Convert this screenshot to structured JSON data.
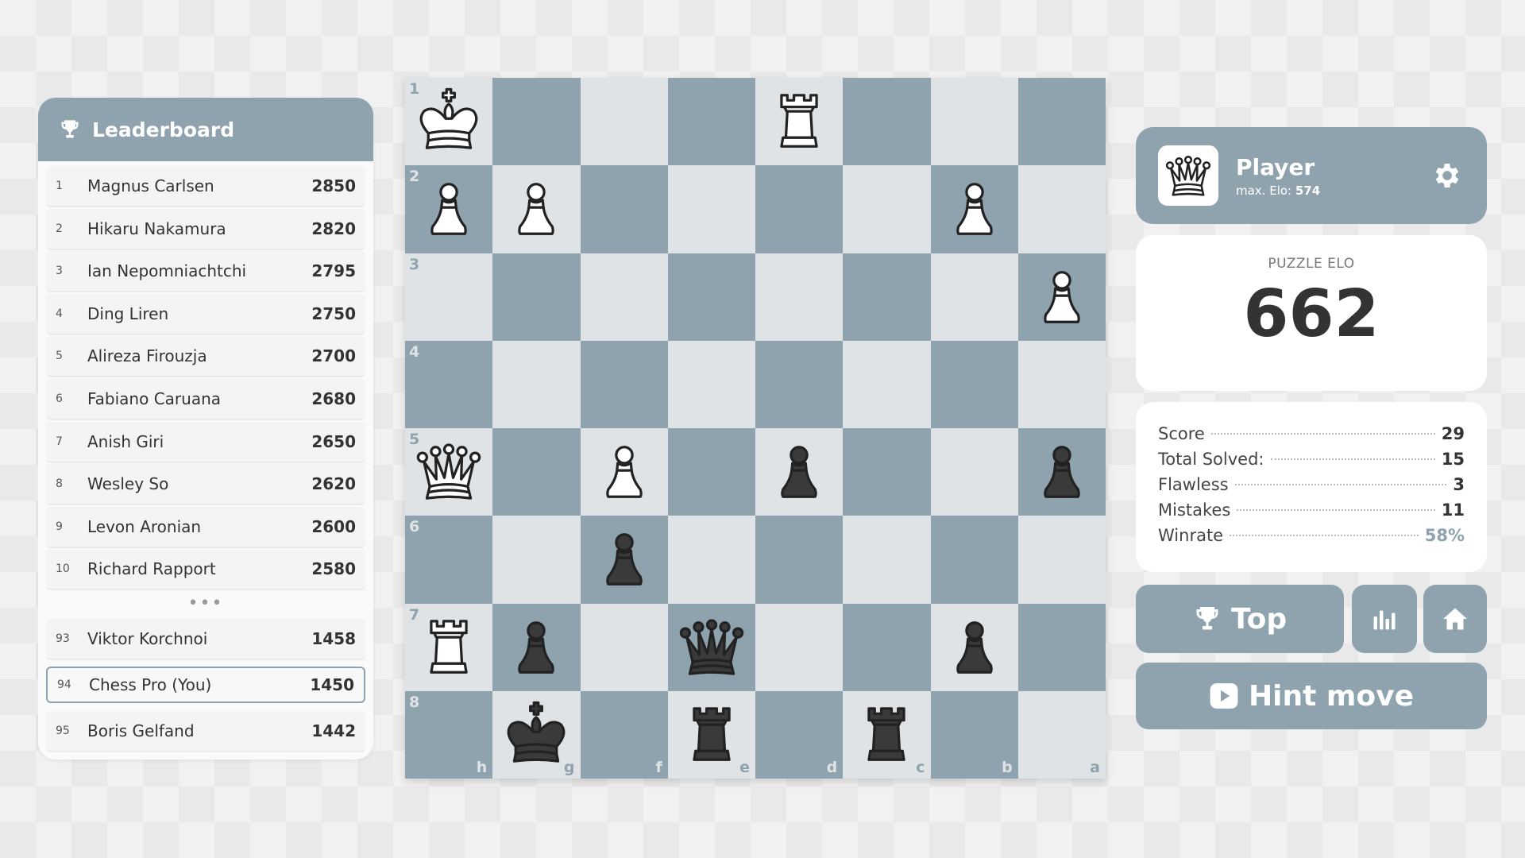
{
  "leaderboard": {
    "title": "Leaderboard",
    "top": [
      {
        "rank": "1",
        "name": "Magnus Carlsen",
        "score": "2850"
      },
      {
        "rank": "2",
        "name": "Hikaru Nakamura",
        "score": "2820"
      },
      {
        "rank": "3",
        "name": "Ian Nepomniachtchi",
        "score": "2795"
      },
      {
        "rank": "4",
        "name": "Ding Liren",
        "score": "2750"
      },
      {
        "rank": "5",
        "name": "Alireza Firouzja",
        "score": "2700"
      },
      {
        "rank": "6",
        "name": "Fabiano Caruana",
        "score": "2680"
      },
      {
        "rank": "7",
        "name": "Anish Giri",
        "score": "2650"
      },
      {
        "rank": "8",
        "name": "Wesley So",
        "score": "2620"
      },
      {
        "rank": "9",
        "name": "Levon Aronian",
        "score": "2600"
      },
      {
        "rank": "10",
        "name": "Richard Rapport",
        "score": "2580"
      }
    ],
    "ellipsis": "•••",
    "nearby": [
      {
        "rank": "93",
        "name": "Viktor Korchnoi",
        "score": "1458"
      },
      {
        "rank": "94",
        "name": "Chess Pro (You)",
        "score": "1450",
        "you": true
      },
      {
        "rank": "95",
        "name": "Boris Gelfand",
        "score": "1442"
      }
    ]
  },
  "board": {
    "ranks": [
      "1",
      "2",
      "3",
      "4",
      "5",
      "6",
      "7",
      "8"
    ],
    "files": [
      "h",
      "g",
      "f",
      "e",
      "d",
      "c",
      "b",
      "a"
    ],
    "colors": {
      "light": "#dfe3e6",
      "dark": "#8ea3ad"
    },
    "pieces": [
      [
        "wK",
        "",
        "",
        "",
        "wR",
        "",
        "",
        ""
      ],
      [
        "wP",
        "wP",
        "",
        "",
        "",
        "",
        "wP",
        ""
      ],
      [
        "",
        "",
        "",
        "",
        "",
        "",
        "",
        "wP"
      ],
      [
        "",
        "",
        "",
        "",
        "",
        "",
        "",
        ""
      ],
      [
        "wQ",
        "",
        "wP",
        "",
        "bP",
        "",
        "",
        "bP"
      ],
      [
        "",
        "",
        "bP",
        "",
        "",
        "",
        "",
        ""
      ],
      [
        "wR",
        "bP",
        "",
        "bQ",
        "",
        "",
        "bP",
        ""
      ],
      [
        "",
        "bK",
        "",
        "bR",
        "",
        "bR",
        "",
        ""
      ]
    ]
  },
  "player": {
    "name": "Player",
    "max_elo_label": "max. Elo:",
    "max_elo": "574",
    "avatar_icon": "queen-icon",
    "settings_icon": "gear-icon"
  },
  "elo": {
    "label": "PUZZLE ELO",
    "value": "662"
  },
  "stats": [
    {
      "label": "Score",
      "value": "29"
    },
    {
      "label": "Total Solved:",
      "value": "15"
    },
    {
      "label": "Flawless",
      "value": "3"
    },
    {
      "label": "Mistakes",
      "value": "11"
    },
    {
      "label": "Winrate",
      "value": "58%",
      "accent": true
    }
  ],
  "buttons": {
    "top_label": "Top",
    "hint_label": "Hint move",
    "stats_icon": "bar-chart-icon",
    "home_icon": "home-icon"
  },
  "accent_color": "#8ea3ad"
}
